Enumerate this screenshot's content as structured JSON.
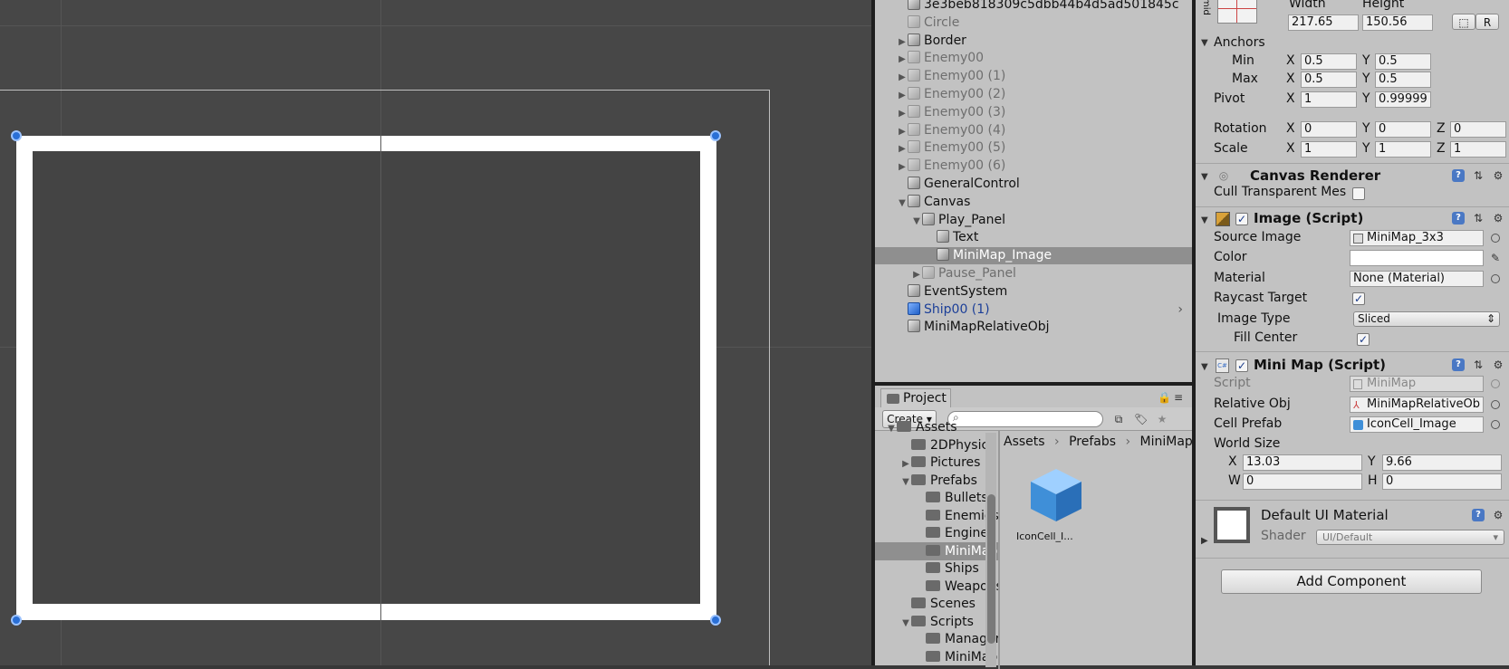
{
  "scene": {},
  "hierarchy": {
    "items": [
      {
        "label": "3e3beb818309c5dbb44b4d5ad501845c",
        "indent": 2,
        "arrow": "",
        "style": "normal"
      },
      {
        "label": "Circle",
        "indent": 2,
        "arrow": "",
        "style": "dim"
      },
      {
        "label": "Border",
        "indent": 2,
        "arrow": "▶",
        "style": "normal"
      },
      {
        "label": "Enemy00",
        "indent": 2,
        "arrow": "▶",
        "style": "dim"
      },
      {
        "label": "Enemy00 (1)",
        "indent": 2,
        "arrow": "▶",
        "style": "dim"
      },
      {
        "label": "Enemy00 (2)",
        "indent": 2,
        "arrow": "▶",
        "style": "dim"
      },
      {
        "label": "Enemy00 (3)",
        "indent": 2,
        "arrow": "▶",
        "style": "dim"
      },
      {
        "label": "Enemy00 (4)",
        "indent": 2,
        "arrow": "▶",
        "style": "dim"
      },
      {
        "label": "Enemy00 (5)",
        "indent": 2,
        "arrow": "▶",
        "style": "dim"
      },
      {
        "label": "Enemy00 (6)",
        "indent": 2,
        "arrow": "▶",
        "style": "dim"
      },
      {
        "label": "GeneralControl",
        "indent": 2,
        "arrow": "",
        "style": "normal"
      },
      {
        "label": "Canvas",
        "indent": 2,
        "arrow": "▼",
        "style": "normal"
      },
      {
        "label": "Play_Panel",
        "indent": 3,
        "arrow": "▼",
        "style": "normal"
      },
      {
        "label": "Text",
        "indent": 4,
        "arrow": "",
        "style": "normal"
      },
      {
        "label": "MiniMap_Image",
        "indent": 4,
        "arrow": "",
        "style": "sel"
      },
      {
        "label": "Pause_Panel",
        "indent": 3,
        "arrow": "▶",
        "style": "dim"
      },
      {
        "label": "EventSystem",
        "indent": 2,
        "arrow": "",
        "style": "normal"
      },
      {
        "label": "Ship00 (1)",
        "indent": 2,
        "arrow": "",
        "style": "blue"
      },
      {
        "label": "MiniMapRelativeObj",
        "indent": 2,
        "arrow": "",
        "style": "normal"
      }
    ]
  },
  "project": {
    "tab_label": "Project",
    "create_label": "Create",
    "search_placeholder": "",
    "tree": [
      {
        "label": "Assets",
        "indent": 1,
        "arrow": "▼",
        "partial": true
      },
      {
        "label": "2DPhysics",
        "indent": 2,
        "arrow": ""
      },
      {
        "label": "Pictures",
        "indent": 2,
        "arrow": "▶"
      },
      {
        "label": "Prefabs",
        "indent": 2,
        "arrow": "▼"
      },
      {
        "label": "Bullets",
        "indent": 3,
        "arrow": ""
      },
      {
        "label": "Enemies",
        "indent": 3,
        "arrow": ""
      },
      {
        "label": "Engines",
        "indent": 3,
        "arrow": ""
      },
      {
        "label": "MiniMap",
        "indent": 3,
        "arrow": "",
        "sel": true
      },
      {
        "label": "Ships",
        "indent": 3,
        "arrow": ""
      },
      {
        "label": "Weapons",
        "indent": 3,
        "arrow": ""
      },
      {
        "label": "Scenes",
        "indent": 2,
        "arrow": ""
      },
      {
        "label": "Scripts",
        "indent": 2,
        "arrow": "▼"
      },
      {
        "label": "Managers",
        "indent": 3,
        "arrow": ""
      },
      {
        "label": "MiniMap",
        "indent": 3,
        "arrow": ""
      }
    ],
    "breadcrumb": [
      "Assets",
      "Prefabs",
      "MiniMap"
    ],
    "asset_label": "IconCell_I..."
  },
  "inspector": {
    "rect": {
      "preset_label": "mid",
      "width_label": "Width",
      "height_label": "Height",
      "width": "217.65",
      "height": "150.56",
      "anchors_label": "Anchors",
      "min_label": "Min",
      "max_label": "Max",
      "min_x": "0.5",
      "min_y": "0.5",
      "max_x": "0.5",
      "max_y": "0.5",
      "pivot_label": "Pivot",
      "pivot_x": "1",
      "pivot_y": "0.99999",
      "rotation_label": "Rotation",
      "rot_x": "0",
      "rot_y": "0",
      "rot_z": "0",
      "scale_label": "Scale",
      "scale_x": "1",
      "scale_y": "1",
      "scale_z": "1",
      "x_label": "X",
      "y_label": "Y",
      "z_label": "Z",
      "r_label": "R"
    },
    "canvas_renderer": {
      "title": "Canvas Renderer",
      "cull_label": "Cull Transparent Mes"
    },
    "image": {
      "title": "Image (Script)",
      "source_label": "Source Image",
      "source_value": "MiniMap_3x3",
      "color_label": "Color",
      "material_label": "Material",
      "material_value": "None (Material)",
      "raycast_label": "Raycast Target",
      "type_label": "Image Type",
      "type_value": "Sliced",
      "fill_label": "Fill Center"
    },
    "minimap": {
      "title": "Mini Map (Script)",
      "script_label": "Script",
      "script_value": "MiniMap",
      "relative_label": "Relative Obj",
      "relative_value": "MiniMapRelativeOb",
      "cell_label": "Cell Prefab",
      "cell_value": "IconCell_Image",
      "world_label": "World Size",
      "x_label": "X",
      "x_value": "13.03",
      "y_label": "Y",
      "y_value": "9.66",
      "w_label": "W",
      "w_value": "0",
      "h_label": "H",
      "h_value": "0"
    },
    "material": {
      "title": "Default UI Material",
      "shader_label": "Shader",
      "shader_value": "UI/Default"
    },
    "add_component_label": "Add Component"
  }
}
